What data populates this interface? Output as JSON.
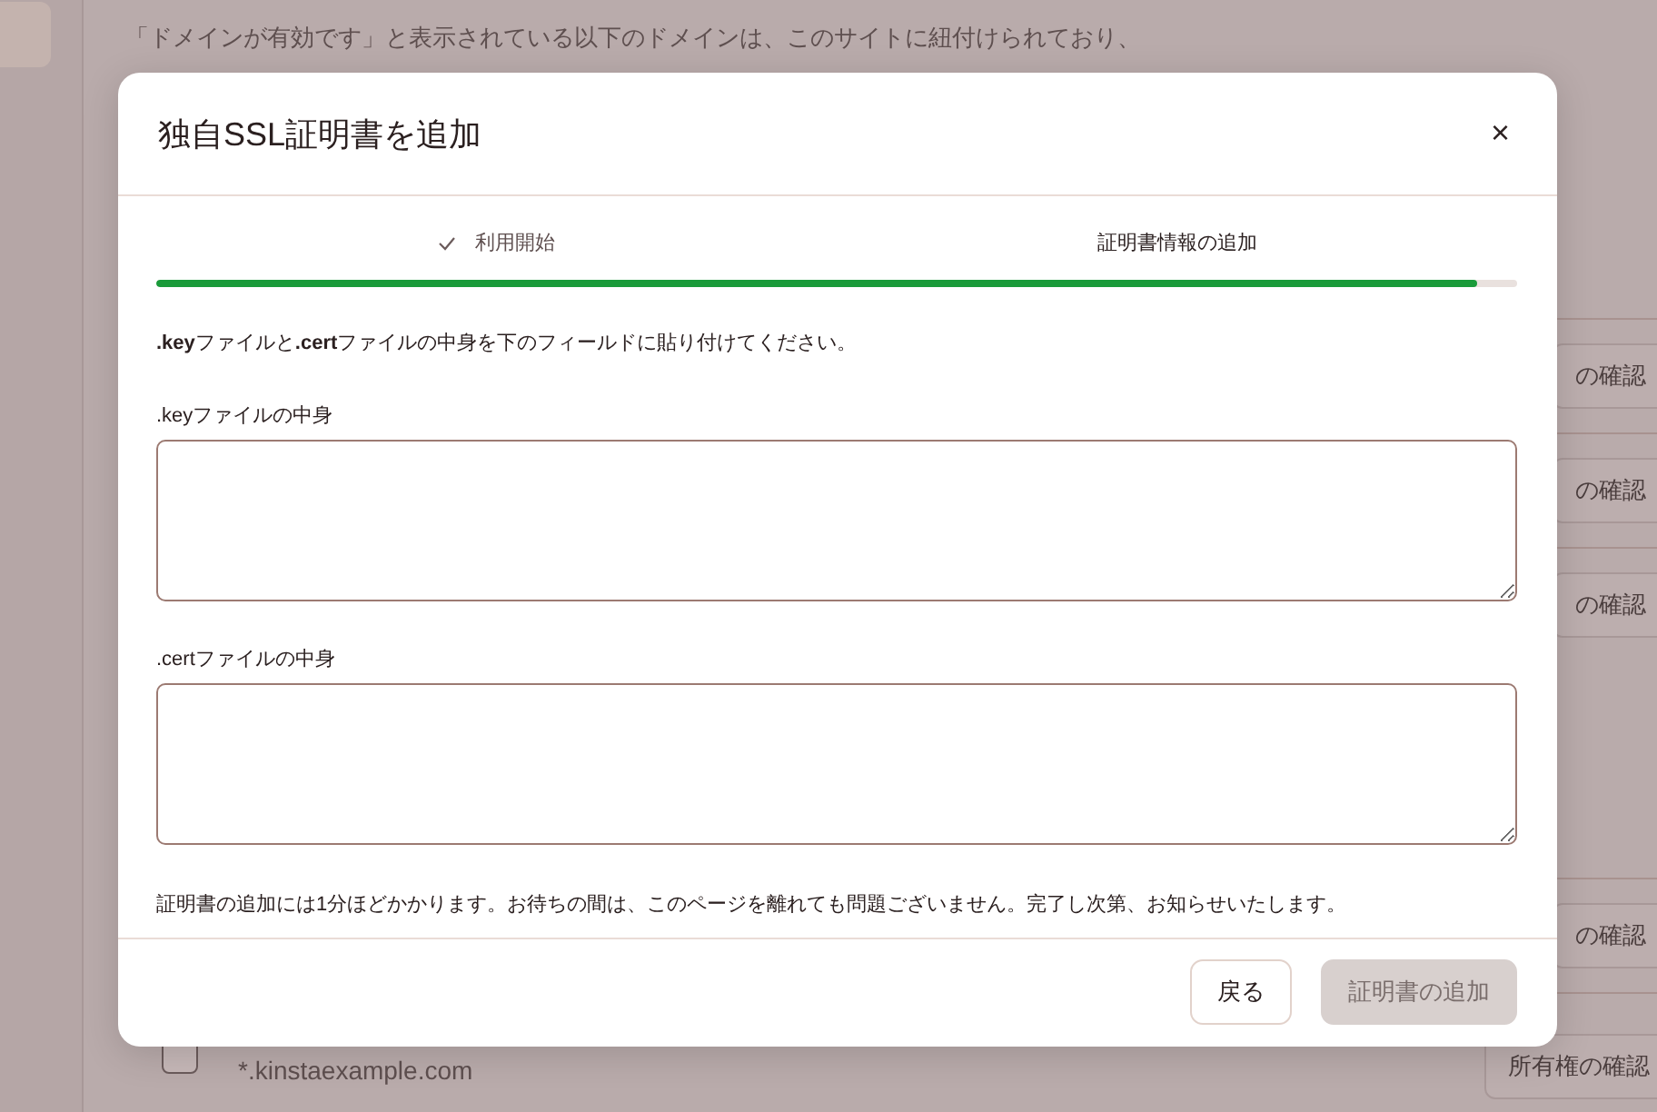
{
  "background": {
    "intro": [
      "「ドメインが有効です」と表示されている以下のドメインは、このサイトに紐付けられており、"
    ],
    "rows": [
      {
        "button": "の確認"
      },
      {
        "button": "の確認"
      },
      {
        "button": "の確認"
      },
      {
        "button": "の確認"
      },
      {
        "button": "所有権の確認",
        "domain": "*.kinstaexample.com",
        "checked": false
      }
    ]
  },
  "dialog": {
    "title": "独自SSL証明書を追加",
    "close": "×",
    "steps": [
      {
        "label": "利用開始",
        "done": true
      },
      {
        "label": "証明書情報の追加",
        "done": false
      }
    ],
    "progress": {
      "level": 0.97
    },
    "instructions": "**.key**ファイルと**.cert**ファイルの中身を下のフィールドに貼り付けてください。",
    "fields": [
      {
        "label": ".keyファイルの中身"
      },
      {
        "label": ".certファイルの中身"
      }
    ],
    "note": "証明書の追加には1分ほどかかります。お待ちの間は、このページを離れても問題ございません。完了し次第、お知らせいたします。",
    "buttons": [
      {
        "label": "戻る",
        "disabled": false,
        "primary": false
      },
      {
        "label": "証明書の追加",
        "disabled": true,
        "primary": true
      }
    ]
  }
}
